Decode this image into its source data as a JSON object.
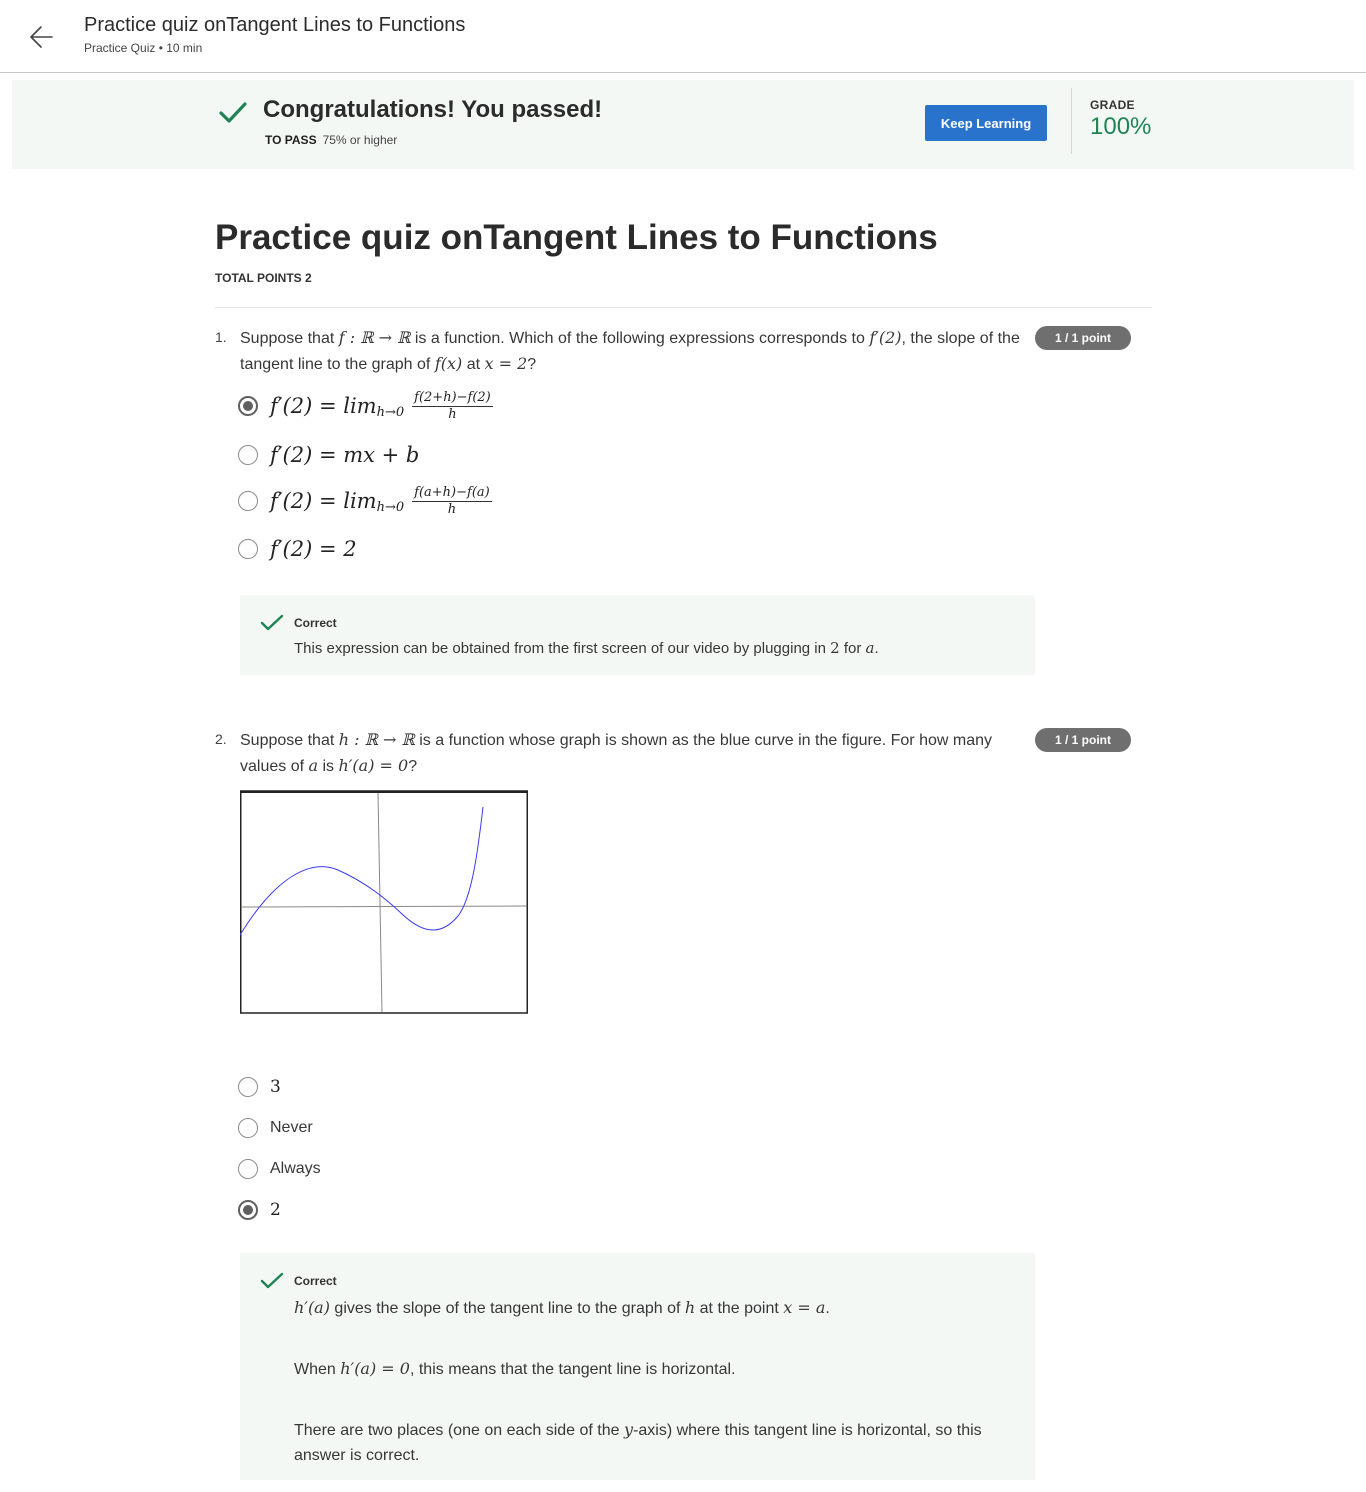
{
  "header": {
    "title": "Practice quiz onTangent Lines to Functions",
    "subtitle": "Practice Quiz • 10 min"
  },
  "banner": {
    "title": "Congratulations! You passed!",
    "to_pass_label": "TO PASS",
    "to_pass_value": "75% or higher",
    "button_label": "Keep Learning",
    "grade_label": "GRADE",
    "grade_value": "100%",
    "accent_color": "#1f8354",
    "button_color": "#2a73cc"
  },
  "quiz": {
    "title": "Practice quiz onTangent Lines to Functions",
    "total_points": "TOTAL POINTS 2"
  },
  "q1": {
    "number": "1.",
    "points": "1 / 1 point",
    "text": {
      "t1": "Suppose that ",
      "m1": "f : ℝ → ℝ",
      "t2": " is a function. Which of the following expressions corresponds to ",
      "m2": "f′(2)",
      "t3": ", the slope of the tangent line to the graph of ",
      "m3": "f(x)",
      "t4": " at ",
      "m4": "x = 2",
      "t5": "?"
    },
    "options": [
      {
        "lhs": "f′(2) = lim",
        "sub": "h→0",
        "num": "f(2+h)−f(2)",
        "den": "h",
        "selected": true
      },
      {
        "lhs": "f′(2) = mx + b",
        "selected": false
      },
      {
        "lhs": "f′(2) = lim",
        "sub": "h→0",
        "num": "f(a+h)−f(a)",
        "den": "h",
        "selected": false
      },
      {
        "lhs": "f′(2) = 2",
        "selected": false
      }
    ],
    "feedback": {
      "title": "Correct",
      "t1": "This expression can be obtained from the first screen of our video by plugging in ",
      "m1": "2",
      "t2": " for ",
      "m2": "a",
      "t3": "."
    }
  },
  "q2": {
    "number": "2.",
    "points": "1 / 1 point",
    "text": {
      "t1": "Suppose that ",
      "m1": "h : ℝ → ℝ",
      "t2": " is a function whose graph is shown as the blue curve in the figure. For how many values of ",
      "m2": "a",
      "t3": " is ",
      "m3": "h′(a) = 0",
      "t4": "?"
    },
    "curve_color": "#3a3af0",
    "options": [
      {
        "label": "3",
        "math": true,
        "selected": false
      },
      {
        "label": "Never",
        "math": false,
        "selected": false
      },
      {
        "label": "Always",
        "math": false,
        "selected": false
      },
      {
        "label": "2",
        "math": true,
        "selected": true
      }
    ],
    "feedback": {
      "title": "Correct",
      "p1": {
        "m1": "h′(a)",
        "t1": " gives the slope of the tangent line to the graph of ",
        "m2": "h",
        "t2": " at the point ",
        "m3": "x = a",
        "t3": "."
      },
      "p2": {
        "t1": "When ",
        "m1": "h′(a) = 0",
        "t2": ", this means that the tangent line is horizontal."
      },
      "p3": {
        "t1": "There are two places (one on each side of the ",
        "m1": "y",
        "t2": "-axis) where this tangent line is horizontal, so this answer is correct."
      }
    }
  }
}
